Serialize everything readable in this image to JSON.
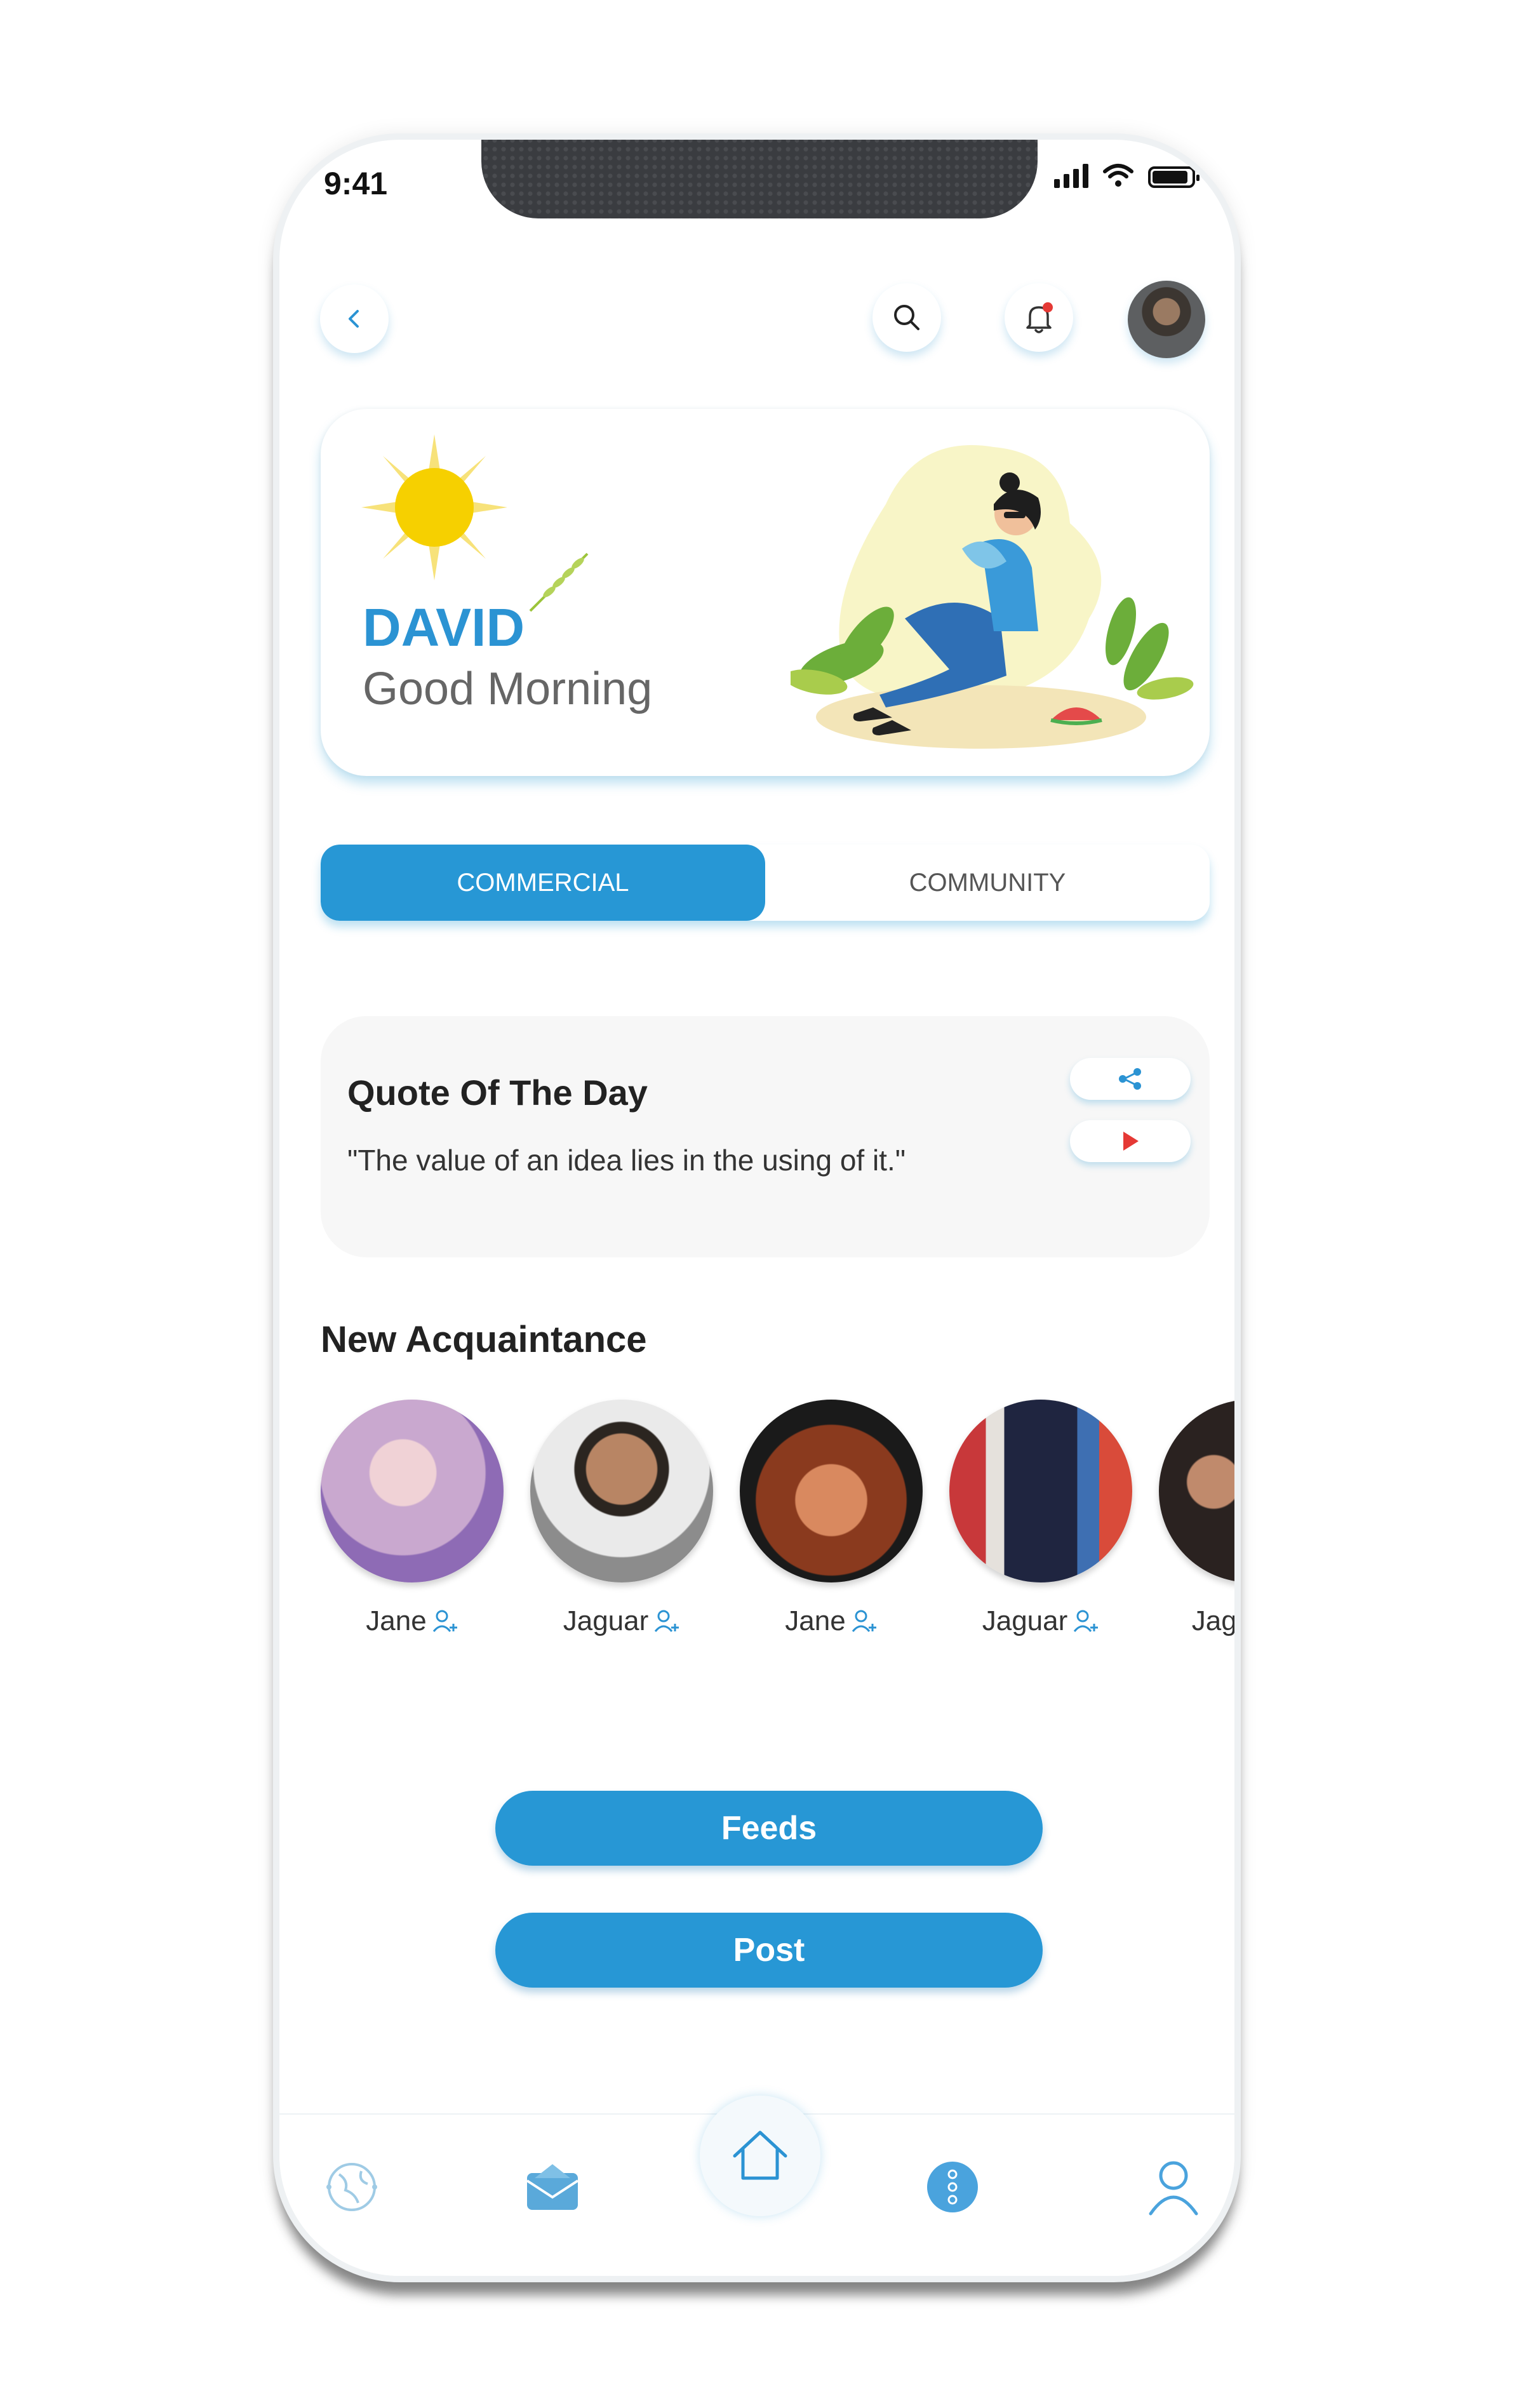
{
  "status_bar": {
    "time": "9:41"
  },
  "header": {
    "back_icon": "chevron-left-icon",
    "search_icon": "search-icon",
    "notification_icon": "bell-icon"
  },
  "greeting": {
    "name": "DAVID",
    "message": "Good Morning"
  },
  "tabs": [
    {
      "label": "COMMERCIAL",
      "active": true
    },
    {
      "label": "COMMUNITY",
      "active": false
    }
  ],
  "quote": {
    "title": "Quote Of The Day",
    "text": "\"The value of an idea lies in the using of it.\""
  },
  "acquaintance": {
    "title": "New Acquaintance",
    "people": [
      {
        "name": "Jane"
      },
      {
        "name": "Jaguar"
      },
      {
        "name": "Jane"
      },
      {
        "name": "Jaguar"
      },
      {
        "name": "Jaguar"
      }
    ]
  },
  "actions": {
    "feeds_label": "Feeds",
    "post_label": "Post"
  },
  "colors": {
    "accent": "#2797d5",
    "notification_dot": "#e53935"
  }
}
